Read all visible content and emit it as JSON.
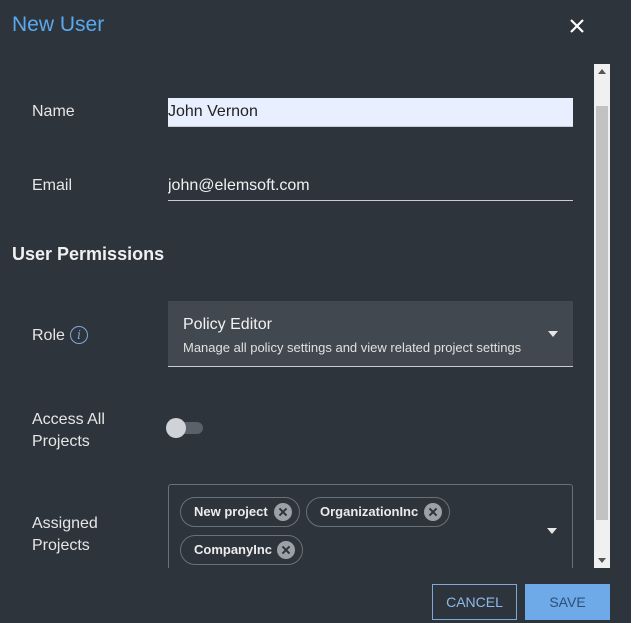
{
  "dialog": {
    "title": "New User"
  },
  "form": {
    "name_label": "Name",
    "name_value": "John Vernon",
    "email_label": "Email",
    "email_value": "john@elemsoft.com"
  },
  "permissions": {
    "section_title": "User Permissions",
    "role_label": "Role",
    "role_selected": "Policy Editor",
    "role_description": "Manage all policy settings and view related project settings",
    "access_all_label": "Access All Projects",
    "access_all_enabled": false,
    "assigned_label": "Assigned Projects",
    "assigned_projects": [
      "New project",
      "OrganizationInc",
      "CompanyInc"
    ]
  },
  "footer": {
    "cancel_label": "CANCEL",
    "save_label": "SAVE"
  },
  "icons": {
    "close": "close-icon",
    "info": "info-icon",
    "dropdown": "chevron-down-icon",
    "remove": "remove-chip-icon"
  },
  "colors": {
    "background": "#2e343c",
    "title": "#5aa9ee",
    "accent": "#6ea9e8"
  }
}
